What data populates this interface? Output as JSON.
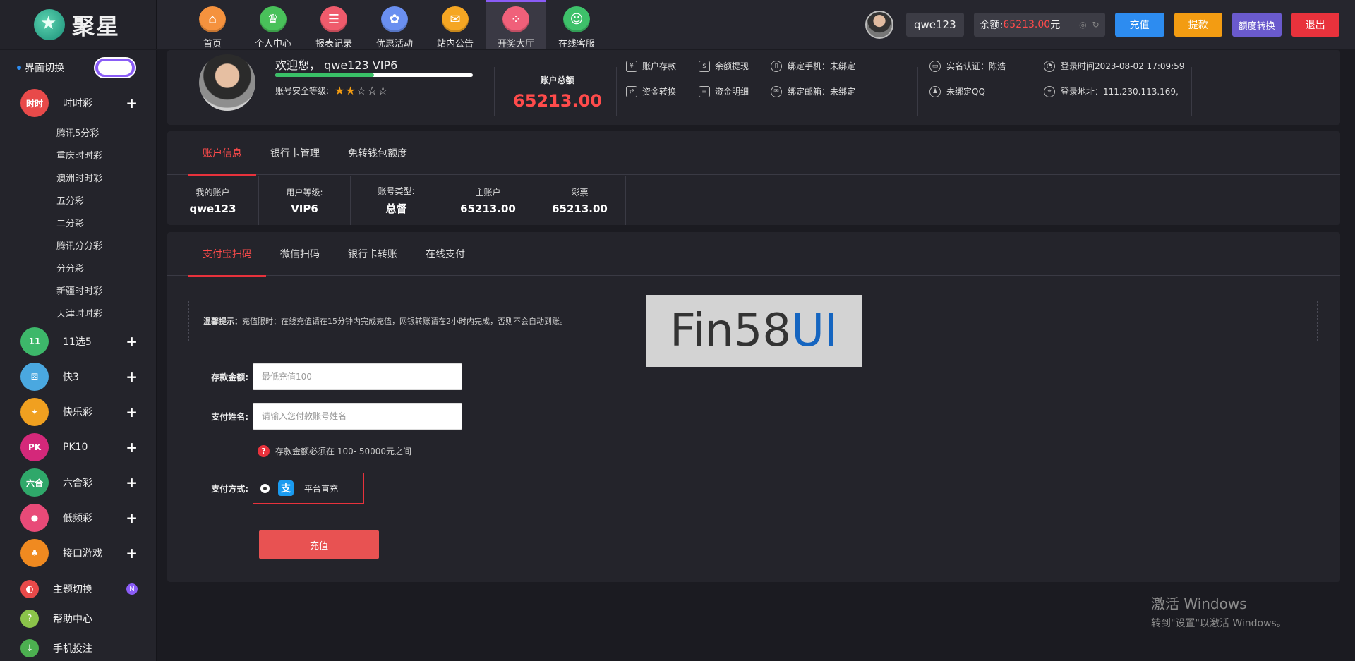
{
  "brand": {
    "name": "聚星"
  },
  "nav": [
    {
      "label": "首页",
      "icon": "home-icon",
      "color": "#f5923e"
    },
    {
      "label": "个人中心",
      "icon": "crown-icon",
      "color": "#49c15a"
    },
    {
      "label": "报表记录",
      "icon": "report-icon",
      "color": "#ef5b6c"
    },
    {
      "label": "优惠活动",
      "icon": "gift-icon",
      "color": "#6a8ff0"
    },
    {
      "label": "站内公告",
      "icon": "mail-icon",
      "color": "#f5a623"
    },
    {
      "label": "开奖大厅",
      "icon": "grid-icon",
      "color": "#f0607a"
    },
    {
      "label": "在线客服",
      "icon": "support-icon",
      "color": "#3ec16a"
    }
  ],
  "header": {
    "username": "qwe123",
    "balance_label": "余额:",
    "balance_value": "65213.00",
    "balance_unit": "元",
    "buttons": {
      "deposit": "充值",
      "withdraw": "提款",
      "transfer": "额度转换",
      "logout": "退出"
    }
  },
  "sidebar": {
    "switch_label": "界面切换",
    "categories": [
      {
        "label": "时时彩",
        "icon": "ssc-icon",
        "color": "#e84a4a",
        "badge": "时时"
      },
      {
        "label": "11选5",
        "icon": "11x5-icon",
        "color": "#3db86a",
        "badge": "11"
      },
      {
        "label": "快3",
        "icon": "k3-icon",
        "color": "#4aa8e0",
        "badge": ""
      },
      {
        "label": "快乐彩",
        "icon": "klc-icon",
        "color": "#f0a020",
        "badge": ""
      },
      {
        "label": "PK10",
        "icon": "pk10-icon",
        "color": "#d4287a",
        "badge": "PK"
      },
      {
        "label": "六合彩",
        "icon": "lhc-icon",
        "color": "#2fa86a",
        "badge": "六合"
      },
      {
        "label": "低频彩",
        "icon": "dpc-icon",
        "color": "#e84a78",
        "badge": ""
      },
      {
        "label": "接口游戏",
        "icon": "api-game-icon",
        "color": "#f08a20",
        "badge": ""
      }
    ],
    "ssc_items": [
      "腾讯5分彩",
      "重庆时时彩",
      "澳洲时时彩",
      "五分彩",
      "二分彩",
      "腾讯分分彩",
      "分分彩",
      "新疆时时彩",
      "天津时时彩"
    ],
    "footer": [
      {
        "label": "主题切换",
        "icon": "theme-icon",
        "color": "#e84a4a",
        "badge": "N"
      },
      {
        "label": "帮助中心",
        "icon": "help-icon",
        "color": "#8bc34a",
        "badge": ""
      },
      {
        "label": "手机投注",
        "icon": "mobile-icon",
        "color": "#4caf50",
        "badge": ""
      }
    ]
  },
  "profile": {
    "welcome": "欢迎您，  qwe123 VIP6",
    "security_label": "账号安全等级:",
    "security_stars": 2,
    "security_stars_max": 5,
    "security_progress": 0.5,
    "total_label": "账户总额",
    "total_value": "65213.00",
    "links": {
      "deposit": "账户存款",
      "withdraw": "余额提现",
      "transfer": "资金转换",
      "details": "资金明细"
    },
    "info": {
      "phone": "绑定手机：未绑定",
      "email": "绑定邮箱：未绑定",
      "realname": "实名认证：陈浩",
      "qq": "未绑定QQ",
      "login_time": "登录时间2023-08-02 17:09:59",
      "login_addr": "登录地址：111.230.113.169,"
    }
  },
  "account_tabs": [
    "账户信息",
    "银行卡管理",
    "免转钱包额度"
  ],
  "account_cells": [
    {
      "label": "我的账户",
      "value": "qwe123"
    },
    {
      "label": "用户等级:",
      "value": "VIP6"
    },
    {
      "label": "账号类型:",
      "value": "总督"
    },
    {
      "label": "主账户",
      "value": "65213.00"
    },
    {
      "label": "彩票",
      "value": "65213.00"
    }
  ],
  "pay_tabs": [
    "支付宝扫码",
    "微信扫码",
    "银行卡转账",
    "在线支付"
  ],
  "notice": {
    "title": "温馨提示：",
    "text": "充值限时：在线充值请在15分钟内完成充值，网银转账请在2小时内完成，否则不会自动到账。"
  },
  "watermark": {
    "main": "Fin58",
    "accent": "UI"
  },
  "form": {
    "amount_label": "存款金额:",
    "amount_placeholder": "最低充值100",
    "name_label": "支付姓名:",
    "name_placeholder": "请输入您付款账号姓名",
    "tip": "存款金额必须在 100- 50000元之间",
    "method_label": "支付方式:",
    "method_option": "平台直充",
    "submit": "充值"
  },
  "windows": {
    "line1": "激活 Windows",
    "line2": "转到\"设置\"以激活 Windows。"
  }
}
